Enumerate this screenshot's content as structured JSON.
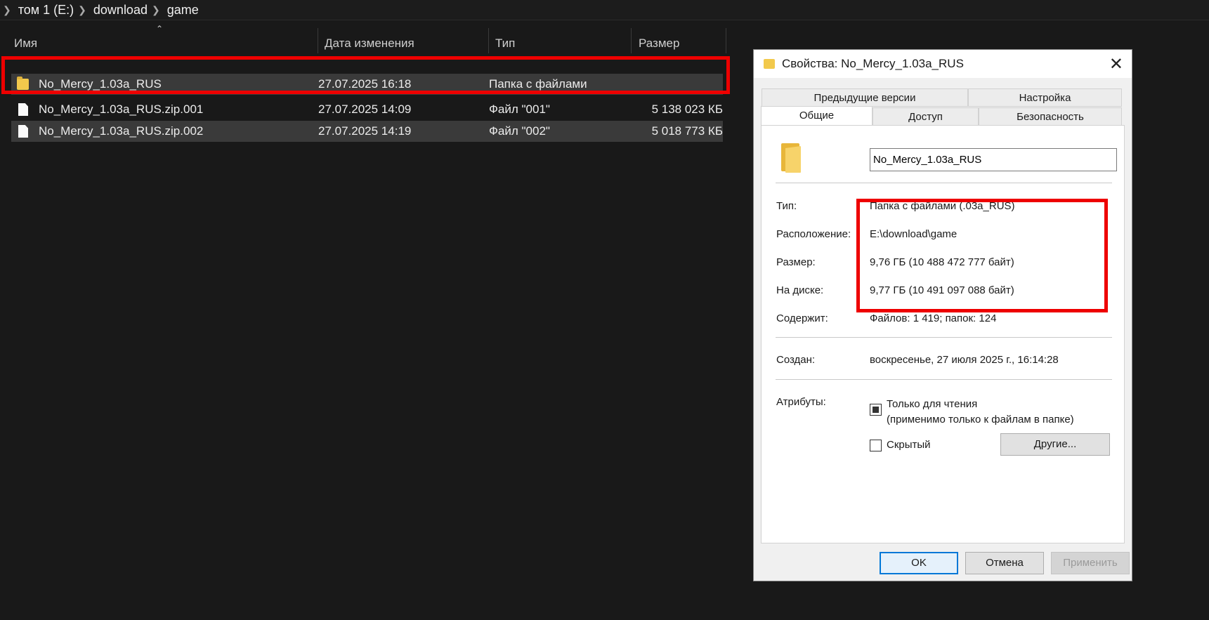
{
  "breadcrumb": [
    "том 1 (E:)",
    "download",
    "game"
  ],
  "columns": {
    "name": "Имя",
    "date": "Дата изменения",
    "type": "Тип",
    "size": "Размер"
  },
  "files": [
    {
      "name": "No_Mercy_1.03a_RUS",
      "date": "27.07.2025 16:18",
      "type": "Папка с файлами",
      "size": "",
      "icon": "folder-icon"
    },
    {
      "name": "No_Mercy_1.03a_RUS.zip.001",
      "date": "27.07.2025 14:09",
      "type": "Файл \"001\"",
      "size": "5 138 023 КБ",
      "icon": "file-icon"
    },
    {
      "name": "No_Mercy_1.03a_RUS.zip.002",
      "date": "27.07.2025 14:19",
      "type": "Файл \"002\"",
      "size": "5 018 773 КБ",
      "icon": "file-icon"
    }
  ],
  "dialog": {
    "title": "Свойства: No_Mercy_1.03a_RUS",
    "tabs_top": [
      "Предыдущие версии",
      "Настройка"
    ],
    "tabs_bottom": [
      "Общие",
      "Доступ",
      "Безопасность"
    ],
    "name_value": "No_Mercy_1.03a_RUS",
    "props": {
      "type_label": "Тип:",
      "type_value": "Папка с файлами (.03a_RUS)",
      "location_label": "Расположение:",
      "location_value": "E:\\download\\game",
      "size_label": "Размер:",
      "size_value": "9,76 ГБ (10 488 472 777 байт)",
      "ondisk_label": "На диске:",
      "ondisk_value": "9,77 ГБ (10 491 097 088 байт)",
      "contains_label": "Содержит:",
      "contains_value": "Файлов: 1 419; папок: 124",
      "created_label": "Создан:",
      "created_value": "воскресенье, 27 июля 2025 г., 16:14:28",
      "attributes_label": "Атрибуты:"
    },
    "readonly_line1": "Только для чтения",
    "readonly_line2": "(применимо только к файлам в папке)",
    "hidden_label": "Скрытый",
    "other_button": "Другие...",
    "ok": "OK",
    "cancel": "Отмена",
    "apply": "Применить"
  },
  "colors": {
    "highlight": "#ee0000",
    "explorer_bg": "#191919",
    "dialog_bg": "#f0f0f0",
    "accent": "#0078d7"
  }
}
